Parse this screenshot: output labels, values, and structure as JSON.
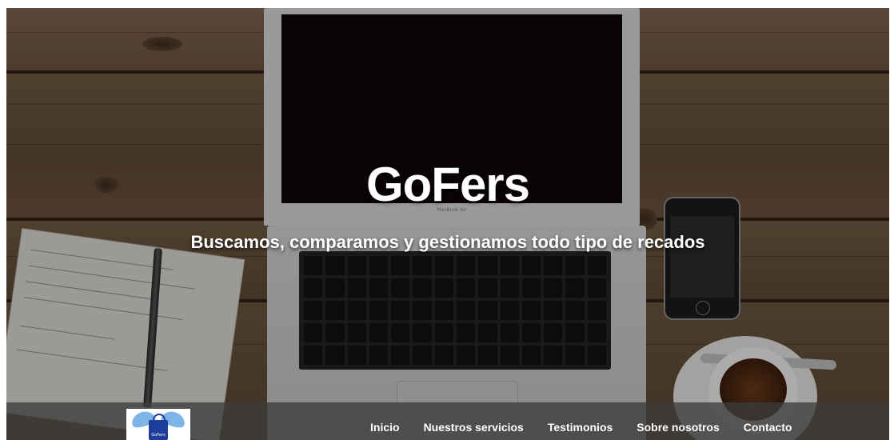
{
  "hero": {
    "title": "GoFers",
    "subtitle": "Buscamos, comparamos y gestionamos todo tipo de recados"
  },
  "background": {
    "laptop_label": "MacBook Air"
  },
  "navbar": {
    "logo_text": "GoFers",
    "links": [
      {
        "label": "Inicio"
      },
      {
        "label": "Nuestros servicios"
      },
      {
        "label": "Testimonios"
      },
      {
        "label": "Sobre nosotros"
      },
      {
        "label": "Contacto"
      }
    ]
  },
  "colors": {
    "overlay_text": "#ffffff",
    "navbar_bg": "#3c3c3c",
    "logo_bag": "#1e3c9a",
    "logo_wings": "#7fb5e6"
  }
}
